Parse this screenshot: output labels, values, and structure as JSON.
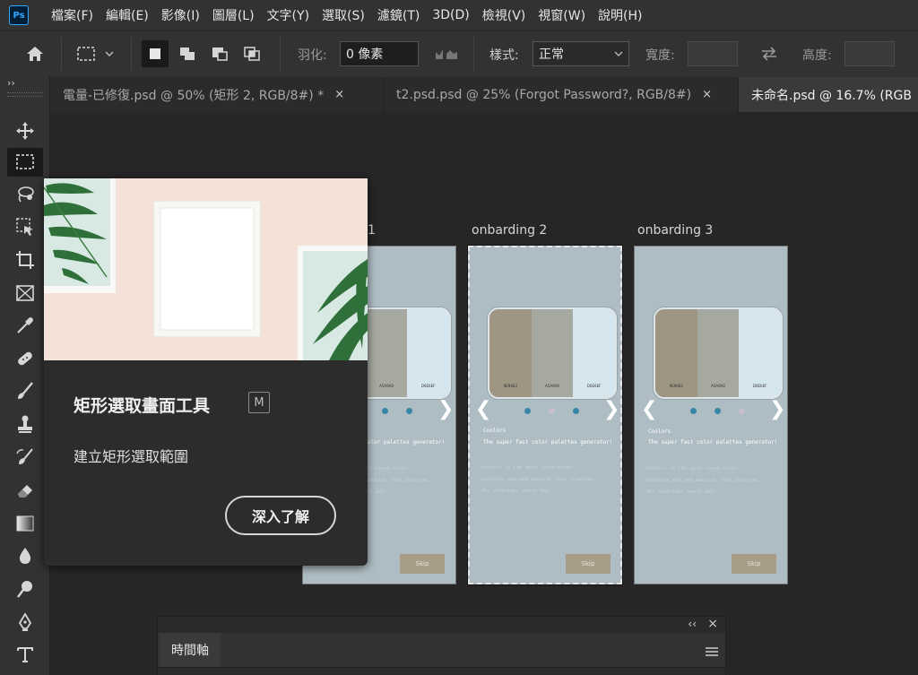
{
  "app": {
    "logo_text": "Ps"
  },
  "menu": [
    "檔案(F)",
    "編輯(E)",
    "影像(I)",
    "圖層(L)",
    "文字(Y)",
    "選取(S)",
    "濾鏡(T)",
    "3D(D)",
    "檢視(V)",
    "視窗(W)",
    "說明(H)"
  ],
  "options": {
    "feather_label": "羽化:",
    "feather_value": "0 像素",
    "style_label": "樣式:",
    "style_value": "正常",
    "width_label": "寬度:",
    "height_label": "高度:"
  },
  "tabs": [
    {
      "label": "電量-已修復.psd @ 50% (矩形 2, RGB/8#) *",
      "close": "×"
    },
    {
      "label": "t2.psd.psd @ 25% (Forgot Password?, RGB/8#)",
      "close": "×"
    },
    {
      "label": "未命名.psd @ 16.7% (RGB",
      "close": ""
    }
  ],
  "panel_collapse": "››",
  "artboards": [
    {
      "title": "onbarding 1",
      "visible_title": "1"
    },
    {
      "title": "onbarding 2"
    },
    {
      "title": "onbarding 3"
    }
  ],
  "screen": {
    "swatch_labels": [
      "9E9683",
      "A5A9A0",
      "D6E6EF"
    ],
    "heading": "Coolors",
    "tagline": "The super fast color palettes generator!",
    "body_lines": [
      "Coolors is the most loved color",
      "palettes app and website that inspires",
      "2M+ creatives every day!"
    ],
    "skip": "Skip"
  },
  "tooltip": {
    "title": "矩形選取畫面工具",
    "shortcut": "M",
    "description": "建立矩形選取範圍",
    "learn_more": "深入了解"
  },
  "timeline": {
    "tab": "時間軸",
    "collapse": "‹‹",
    "close": "×"
  },
  "colors": {
    "accent": "#31a8ff",
    "canvas": "#262626",
    "panel": "#323232",
    "artboard_bg": "#aebdc4",
    "swatch_1": "#9e9683",
    "swatch_2": "#a5a9a0",
    "swatch_3": "#d6e6ef",
    "dot_active": "#3a86a8",
    "dot_inactive": "#c7bfcf",
    "skip_bg": "#a79d89"
  }
}
